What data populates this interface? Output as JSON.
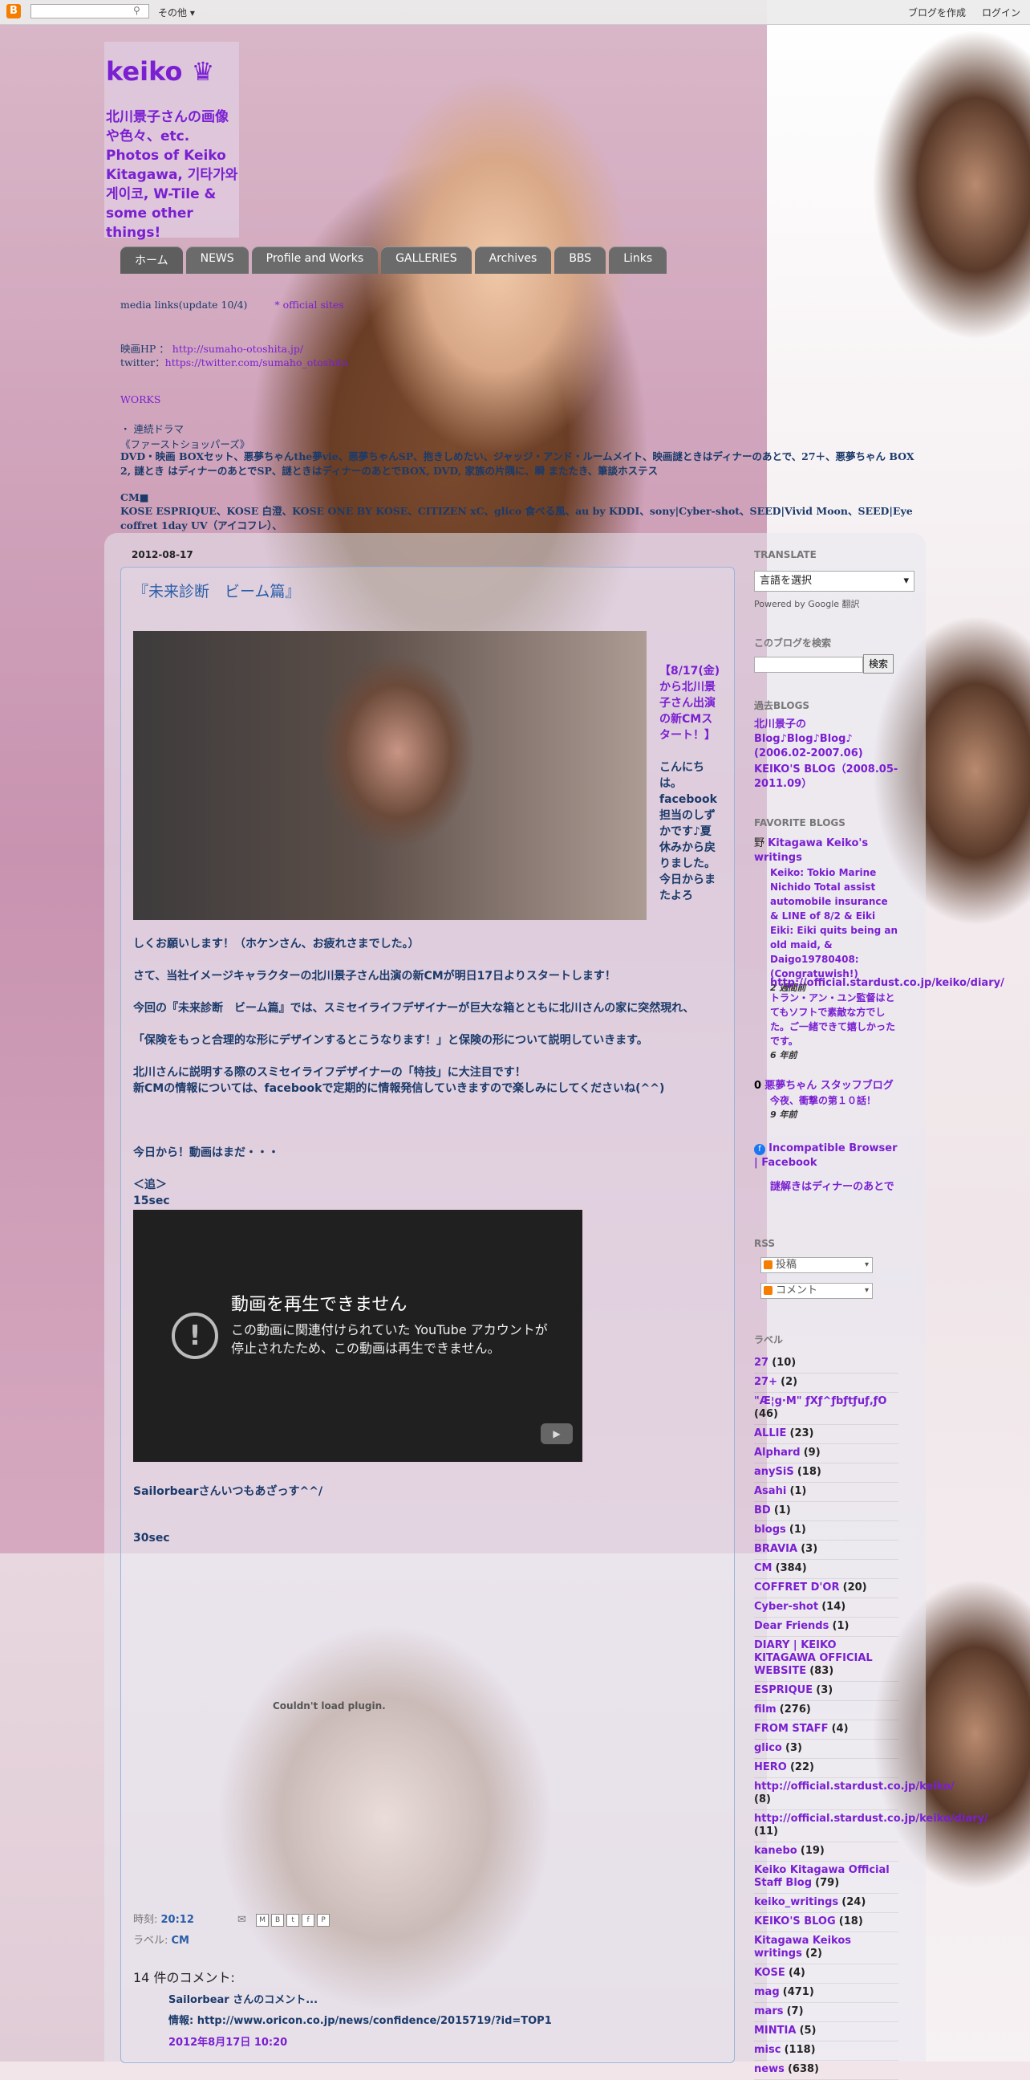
{
  "navbar": {
    "logo": "B",
    "more": "その他 ▾",
    "create_blog": "ブログを作成",
    "login": "ログイン"
  },
  "header": {
    "title": "keiko ♛",
    "description": "北川景子さんの画像や色々、etc. Photos of Keiko Kitagawa, 기타가와 게이코, W-Tile & some other things!",
    "tabs": [
      "ホーム",
      "NEWS",
      "Profile and Works",
      "GALLERIES",
      "Archives",
      "BBS",
      "Links"
    ],
    "line1": "media links(update 10/4)",
    "line1_link": "* official sites",
    "line2_prefix": "映画HP ： ",
    "line2_link": "http://sumaho-otoshita.jp/",
    "line3_prefix": "twitter：",
    "line3_link": "https://twitter.com/sumaho_otoshita",
    "section": "WORKS",
    "works1": "・ 連続ドラマ",
    "works2": "《ファーストショッパーズ》",
    "works3": "DVD・映画 BOXセット、悪夢ちゃんthe夢vie、悪夢ちゃんSP、抱きしめたい、ジャッジ・アンド・ルームメイト、映画謎ときはディナーのあとで、27＋、悪夢ちゃん BOX 2, 謎とき はディナーのあとでSP、謎ときはディナーのあとでBOX, DVD, 家族の片隅に、瞬 またたき、筆談ホステス",
    "cm_title": "CM■",
    "cm_line1": "KOSE ESPRIQUE、KOSE 白澄、KOSE ONE BY KOSE、CITIZEN xC、glico 食べる風、au by KDDI、sony|Cyber-shot、SEED|Vivid Moon、SEED|Eye coffret 1day UV（アイコフレ）、"
  },
  "post": {
    "date": "2012-08-17",
    "title": "『未来診断　ビーム篇』",
    "side_line1": "【8/17(金)から北川景子さん出演の新CMスタート！】",
    "side_line2": "こんにちは。facebook担当のしずかです♪夏休みから戻りました。今日からまたよろ",
    "p1": "しくお願いします！（ホケンさん、お疲れさまでした。）",
    "p2": "さて、当社イメージキャラクターの北川景子さん出演の新CMが明日17日よりスタートします！",
    "p3a": "今回の『未来診断　ビーム篇』では、スミセイライフデザイナーが巨大な箱とともに北川さんの家に突然現れ、",
    "p3b": "「保険をもっと合理的な形にデザインするとこうなります！」と保険の形について説明していきます。",
    "p4a": "北川さんに説明する際のスミセイライフデザイナーの「特技」に大注目です！",
    "p4b": "新CMの情報については、facebookで定期的に情報発信していきますので楽しみにしてくださいね(^^)",
    "p5": "今日から！動画はまだ・・・",
    "p6": "＜追＞",
    "p7": "15sec",
    "video_title": "動画を再生できません",
    "video_desc": "この動画に関連付けられていた YouTube アカウントが停止されたため、この動画は再生できません。",
    "p8": "Sailorbearさんいつもあざっす^^/",
    "p9": "30sec",
    "plugin": "Couldn't load plugin.",
    "time_label": "時刻: ",
    "time": "20:12",
    "label_label": "ラベル: ",
    "label": "CM"
  },
  "comments": {
    "heading": "14 件のコメント:",
    "author": "Sailorbear さんのコメント...",
    "body": "情報: http://www.oricon.co.jp/news/confidence/2015719/?id=TOP1",
    "date": "2012年8月17日 10:20"
  },
  "sidebar": {
    "translate_h": "TRANSLATE",
    "translate_select": "言語を選択",
    "powered": "Powered by Google 翻訳",
    "search_h": "このブログを検索",
    "search_btn": "検索",
    "past_h": "過去BLOGS",
    "past1": "北川景子の Blog♪Blog♪Blog♪ (2006.02-2007.06)",
    "past2": "KEIKO'S BLOG（2008.05-2011.09）",
    "fav_h": "FAVORITE BLOGS",
    "fav1_title": "Kitagawa Keiko's writings",
    "fav1_snip": "Keiko: Tokio Marine Nichido Total assist automobile insurance & LINE of 8/2 & Eiki Eiki: Eiki quits being an old maid, & Daigo19780408: (Congratuwish!)",
    "fav1_time": "2 週間前",
    "fav2_title": "http://official.stardust.co.jp/keiko/diary/",
    "fav2_snip": "トラン・アン・ユン監督はとてもソフトで素敵な方でした。ご一緒できて嬉しかったです。",
    "fav2_time": "6 年前",
    "fav3_title": "悪夢ちゃん スタッフブログ",
    "fav3_snip": "今夜、衝撃の第１０話！",
    "fav3_time": "9 年前",
    "fav4_title": "Incompatible Browser | Facebook",
    "fav5_title": "謎解きはディナーのあとで",
    "rss_h": "RSS",
    "rss1": "投稿",
    "rss2": "コメント",
    "labels_h": "ラベル",
    "labels": [
      {
        "name": "27",
        "count": "(10)"
      },
      {
        "name": "27+",
        "count": "(2)"
      },
      {
        "name": "\"Æ¦g·M\" ƒXƒ^ƒbƒtƒuƒ‚ƒO",
        "count": "(46)"
      },
      {
        "name": "ALLIE",
        "count": "(23)"
      },
      {
        "name": "Alphard",
        "count": "(9)"
      },
      {
        "name": "anySiS",
        "count": "(18)"
      },
      {
        "name": "Asahi",
        "count": "(1)"
      },
      {
        "name": "BD",
        "count": "(1)"
      },
      {
        "name": "blogs",
        "count": "(1)"
      },
      {
        "name": "BRAVIA",
        "count": "(3)"
      },
      {
        "name": "CM",
        "count": "(384)"
      },
      {
        "name": "COFFRET D'OR",
        "count": "(20)"
      },
      {
        "name": "Cyber-shot",
        "count": "(14)"
      },
      {
        "name": "Dear Friends",
        "count": "(1)"
      },
      {
        "name": "DIARY | KEIKO KITAGAWA OFFICIAL WEBSITE",
        "count": "(83)"
      },
      {
        "name": "ESPRIQUE",
        "count": "(3)"
      },
      {
        "name": "film",
        "count": "(276)"
      },
      {
        "name": "FROM STAFF",
        "count": "(4)"
      },
      {
        "name": "glico",
        "count": "(3)"
      },
      {
        "name": "HERO",
        "count": "(22)"
      },
      {
        "name": "http://official.stardust.co.jp/keiko/",
        "count": "(8)"
      },
      {
        "name": "http://official.stardust.co.jp/keiko/diary/",
        "count": "(11)"
      },
      {
        "name": "kanebo",
        "count": "(19)"
      },
      {
        "name": "Keiko Kitagawa Official Staff Blog",
        "count": "(79)"
      },
      {
        "name": "keiko_writings",
        "count": "(24)"
      },
      {
        "name": "KEIKO'S BLOG",
        "count": "(18)"
      },
      {
        "name": "Kitagawa Keikos writings",
        "count": "(2)"
      },
      {
        "name": "KOSE",
        "count": "(4)"
      },
      {
        "name": "mag",
        "count": "(471)"
      },
      {
        "name": "mars",
        "count": "(7)"
      },
      {
        "name": "MINTIA",
        "count": "(5)"
      },
      {
        "name": "misc",
        "count": "(118)"
      },
      {
        "name": "news",
        "count": "(638)"
      }
    ]
  }
}
